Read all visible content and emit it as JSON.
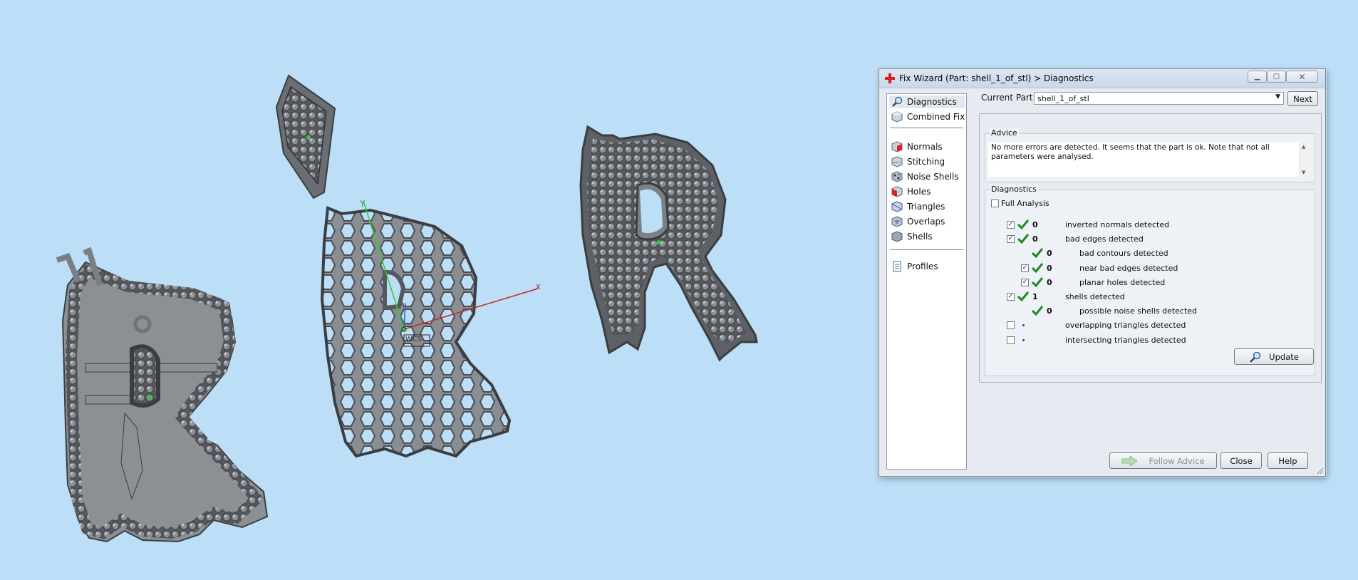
{
  "viewport": {
    "axis_y_label": "Y",
    "axis_x_label": "X",
    "axis_tag": "WCS"
  },
  "dialog": {
    "title": "Fix Wizard (Part: shell_1_of_stl) > Diagnostics",
    "nav_items": [
      {
        "label": "Diagnostics",
        "icon": "magnifier-icon"
      },
      {
        "label": "Combined Fix",
        "icon": "cube-icon"
      },
      {
        "label": "Normals",
        "icon": "normals-cube-icon"
      },
      {
        "label": "Stitching",
        "icon": "stitching-cube-icon"
      },
      {
        "label": "Noise Shells",
        "icon": "noise-shells-icon"
      },
      {
        "label": "Holes",
        "icon": "holes-cube-icon"
      },
      {
        "label": "Triangles",
        "icon": "triangles-icon"
      },
      {
        "label": "Overlaps",
        "icon": "overlaps-icon"
      },
      {
        "label": "Shells",
        "icon": "shells-icon"
      },
      {
        "label": "Profiles",
        "icon": "document-icon"
      }
    ],
    "current_part_label": "Current Part:",
    "current_part_value": "shell_1_of_stl",
    "next_label": "Next",
    "advice_title": "Advice",
    "advice_text": "No more errors are detected. It seems that the part is ok. Note that not all parameters were analysed.",
    "diagnostics_title": "Diagnostics",
    "full_analysis_label": "Full Analysis",
    "rows": [
      {
        "checkbox": true,
        "checked": true,
        "ok": true,
        "count": "0",
        "label": "inverted normals detected",
        "indent": 0
      },
      {
        "checkbox": true,
        "checked": true,
        "ok": true,
        "count": "0",
        "label": "bad edges detected",
        "indent": 0
      },
      {
        "checkbox": false,
        "checked": false,
        "ok": true,
        "count": "0",
        "label": "bad contours detected",
        "indent": 1
      },
      {
        "checkbox": true,
        "checked": true,
        "ok": true,
        "count": "0",
        "label": "near bad edges detected",
        "indent": 1
      },
      {
        "checkbox": true,
        "checked": true,
        "ok": true,
        "count": "0",
        "label": "planar holes detected",
        "indent": 1
      },
      {
        "checkbox": true,
        "checked": true,
        "ok": true,
        "count": "1",
        "label": "shells detected",
        "indent": 0
      },
      {
        "checkbox": false,
        "checked": false,
        "ok": true,
        "count": "0",
        "label": "possible noise shells detected",
        "indent": 1
      },
      {
        "checkbox": true,
        "checked": false,
        "ok": false,
        "count": "",
        "label": "overlapping triangles detected",
        "indent": 0
      },
      {
        "checkbox": true,
        "checked": false,
        "ok": false,
        "count": "",
        "label": "intersecting triangles detected",
        "indent": 0
      }
    ],
    "update_label": "Update",
    "follow_advice_label": "Follow Advice",
    "close_label": "Close",
    "help_label": "Help"
  }
}
